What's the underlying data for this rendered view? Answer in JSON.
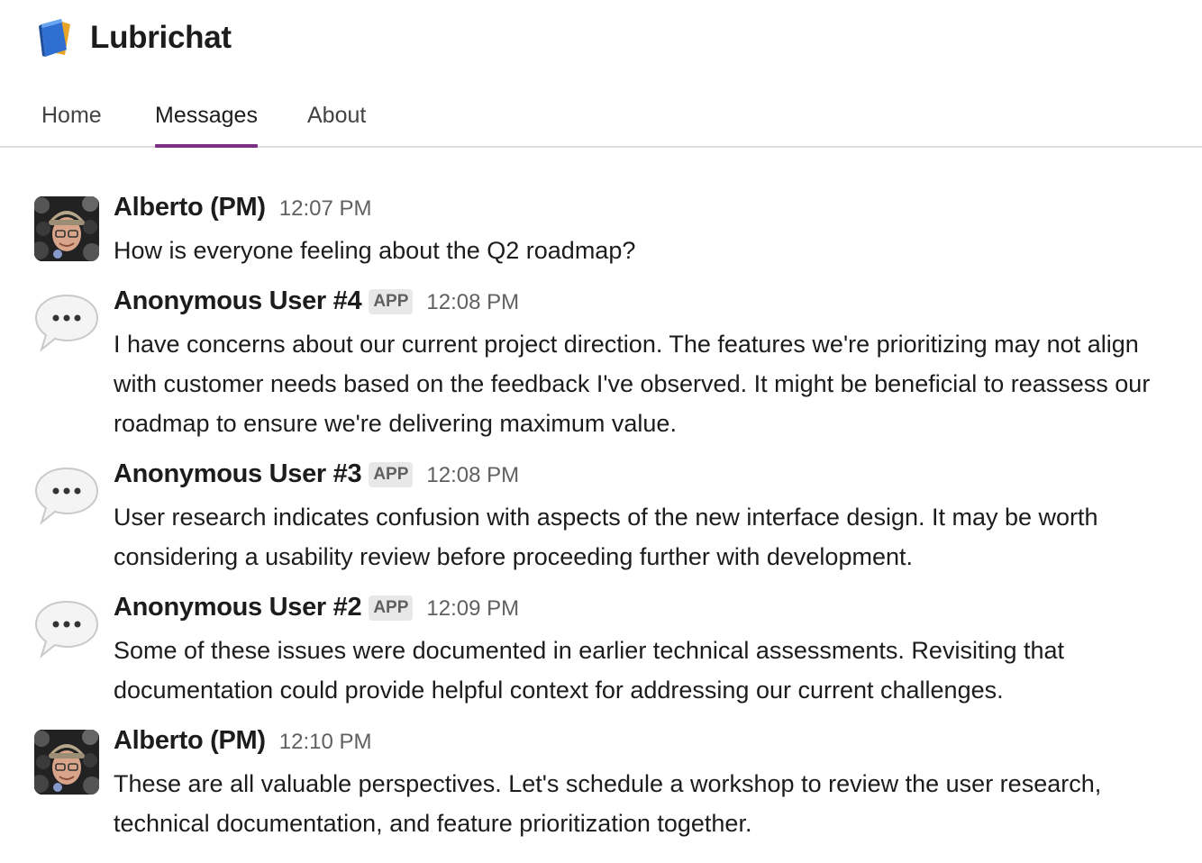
{
  "app": {
    "title": "Lubrichat",
    "icon": "blue-book-icon"
  },
  "tabs": [
    {
      "label": "Home",
      "active": false
    },
    {
      "label": "Messages",
      "active": true
    },
    {
      "label": "About",
      "active": false
    }
  ],
  "accent_color": "#7c3085",
  "messages": [
    {
      "author": "Alberto (PM)",
      "badge": "",
      "time": "12:07 PM",
      "avatar": "user-photo-avatar",
      "text": "How is everyone feeling about the Q2 roadmap?"
    },
    {
      "author": "Anonymous User #4",
      "badge": "APP",
      "time": "12:08 PM",
      "avatar": "speech-bubble-avatar",
      "text": "I have concerns about our current project direction. The features we're prioritizing may not align with customer needs based on the feedback I've observed. It might be beneficial to reassess our roadmap to ensure we're delivering maximum value."
    },
    {
      "author": "Anonymous User #3",
      "badge": "APP",
      "time": "12:08 PM",
      "avatar": "speech-bubble-avatar",
      "text": "User research indicates confusion with aspects of the new interface design. It may be worth considering a usability review before proceeding further with development."
    },
    {
      "author": "Anonymous User #2",
      "badge": "APP",
      "time": "12:09 PM",
      "avatar": "speech-bubble-avatar",
      "text": "Some of these issues were documented in earlier technical assessments. Revisiting that documentation could provide helpful context for addressing our current challenges."
    },
    {
      "author": "Alberto (PM)",
      "badge": "",
      "time": "12:10 PM",
      "avatar": "user-photo-avatar",
      "text": "These are all valuable perspectives. Let's schedule a workshop to review the user research, technical documentation, and feature prioritization together."
    }
  ]
}
